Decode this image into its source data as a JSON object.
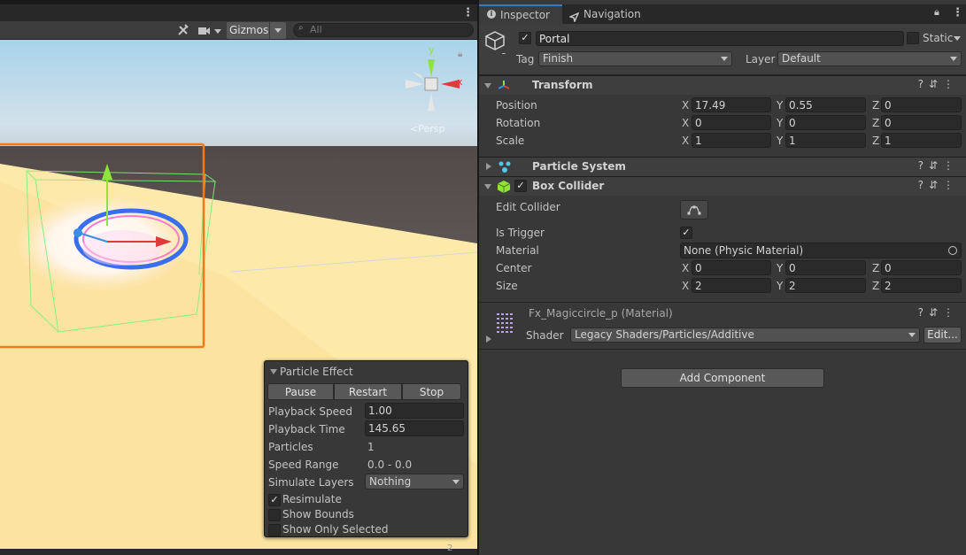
{
  "scene": {
    "toolbar": {
      "gizmos_label": "Gizmos",
      "search_placeholder": "All",
      "persp_label": "Persp"
    },
    "gizmo_axes": {
      "y": "y",
      "x": "x"
    },
    "particle_effect": {
      "title": "Particle Effect",
      "buttons": {
        "pause": "Pause",
        "restart": "Restart",
        "stop": "Stop"
      },
      "playback_speed_label": "Playback Speed",
      "playback_speed": "1.00",
      "playback_time_label": "Playback Time",
      "playback_time": "145.65",
      "particles_label": "Particles",
      "particles": "1",
      "speed_range_label": "Speed Range",
      "speed_range": "0.0 - 0.0",
      "simulate_layers_label": "Simulate Layers",
      "simulate_layers": "Nothing",
      "resimulate_label": "Resimulate",
      "resimulate": true,
      "show_bounds_label": "Show Bounds",
      "show_bounds": false,
      "show_only_selected_label": "Show Only Selected",
      "show_only_selected": false
    },
    "bottom_count": "2"
  },
  "inspector": {
    "tabs": [
      "Inspector",
      "Navigation"
    ],
    "object": {
      "active": true,
      "name": "Portal",
      "static_label": "Static",
      "tag_label": "Tag",
      "tag": "Finish",
      "layer_label": "Layer",
      "layer": "Default"
    },
    "transform": {
      "title": "Transform",
      "position_label": "Position",
      "rotation_label": "Rotation",
      "scale_label": "Scale",
      "axes": [
        "X",
        "Y",
        "Z"
      ],
      "position": [
        "17.49",
        "0.55",
        "0"
      ],
      "rotation": [
        "0",
        "0",
        "0"
      ],
      "scale": [
        "1",
        "1",
        "1"
      ]
    },
    "particle_system": {
      "title": "Particle System"
    },
    "box_collider": {
      "title": "Box Collider",
      "enabled": true,
      "edit_collider_label": "Edit Collider",
      "is_trigger_label": "Is Trigger",
      "is_trigger": true,
      "material_label": "Material",
      "material": "None (Physic Material)",
      "center_label": "Center",
      "center": [
        "0",
        "0",
        "0"
      ],
      "size_label": "Size",
      "size": [
        "2",
        "2",
        "2"
      ]
    },
    "material": {
      "name": "Fx_Magiccircle_p (Material)",
      "shader_label": "Shader",
      "shader": "Legacy Shaders/Particles/Additive",
      "edit_label": "Edit..."
    },
    "add_component_label": "Add Component"
  },
  "colors": {
    "selection_outline": "#f07a1a",
    "bounds_green": "#7cf07c",
    "inspector_bg": "#383838",
    "field_bg": "#2a2a2a"
  }
}
